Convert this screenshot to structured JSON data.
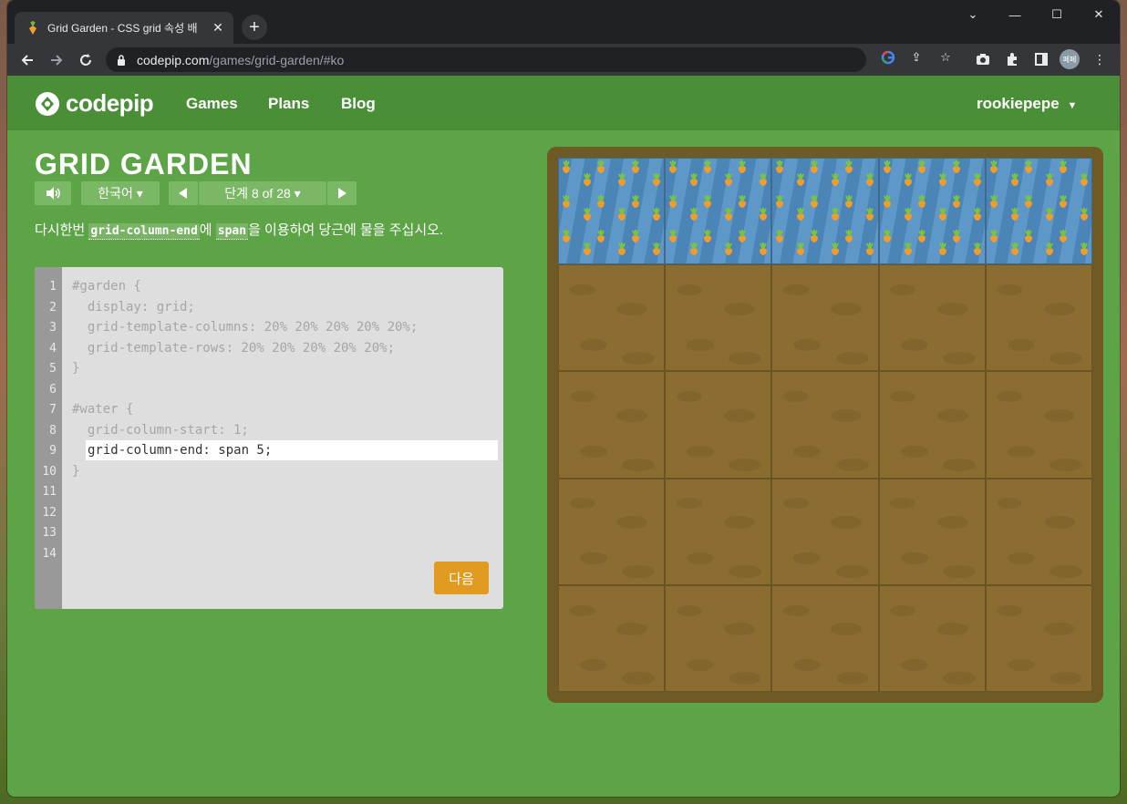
{
  "browser": {
    "tab_title": "Grid Garden - CSS grid 속성 배",
    "url_host": "codepip.com",
    "url_path": "/games/grid-garden/#ko",
    "profile_initials": "페페"
  },
  "site": {
    "logo_text": "codepip",
    "nav": [
      {
        "label": "Games"
      },
      {
        "label": "Plans"
      },
      {
        "label": "Blog"
      }
    ],
    "user_label": "rookiepepe"
  },
  "game": {
    "title": "GRID GARDEN",
    "language": "한국어 ▾",
    "level_label": "단계 8 of 28 ▾",
    "instruction_before": "다시한번 ",
    "instruction_code1": "grid-column-end",
    "instruction_mid": "에 ",
    "instruction_code2": "span",
    "instruction_after": "을 이용하여 당근에 물을 주십시오.",
    "code_lines": [
      "#garden {",
      "  display: grid;",
      "  grid-template-columns: 20% 20% 20% 20% 20%;",
      "  grid-template-rows: 20% 20% 20% 20% 20%;",
      "}",
      "",
      "#water {",
      "  grid-column-start: 1;",
      "",
      "}",
      "",
      "",
      "",
      ""
    ],
    "line_numbers": [
      "1",
      "2",
      "3",
      "4",
      "5",
      "6",
      "7",
      "8",
      "9",
      "10",
      "11",
      "12",
      "13",
      "14"
    ],
    "input_value": "grid-column-end: span 5;",
    "next_label": "다음"
  },
  "colors": {
    "background": "#5ca445",
    "header": "#4a8f38",
    "next_button": "#e19b20",
    "soil": "#8b6d32",
    "water": "#4b84b6"
  }
}
